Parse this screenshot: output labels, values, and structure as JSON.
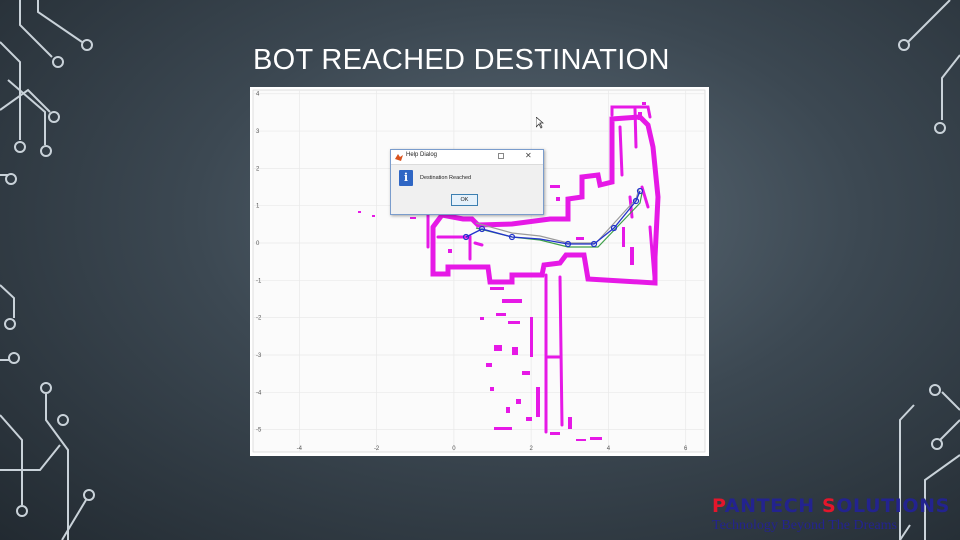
{
  "slide": {
    "title": "BOT REACHED DESTINATION"
  },
  "plot": {
    "y_ticks": [
      "4",
      "3",
      "2",
      "1",
      "0",
      "-1",
      "-2",
      "-3",
      "-4",
      "-5"
    ],
    "x_ticks": [
      "-4",
      "-2",
      "0",
      "2",
      "4",
      "6"
    ],
    "xlim": [
      -5.2,
      6.5
    ],
    "ylim": [
      -5.6,
      4.1
    ],
    "colors": {
      "map": "#e619e6",
      "path": "#2233cc",
      "offset_green": "#3fa04a",
      "offset_gray": "#9a9a9a",
      "grid": "#e9e9e9"
    }
  },
  "dialog": {
    "title": "Help Dialog",
    "message": "Destination Reached",
    "ok_label": "OK",
    "icon": "info-icon"
  },
  "logo": {
    "brand_prefix": "P",
    "brand_middle": "ANTECH ",
    "brand_accent": "S",
    "brand_suffix": "OLUTIONS",
    "tagline": "Technology Beyond The Dreams"
  }
}
